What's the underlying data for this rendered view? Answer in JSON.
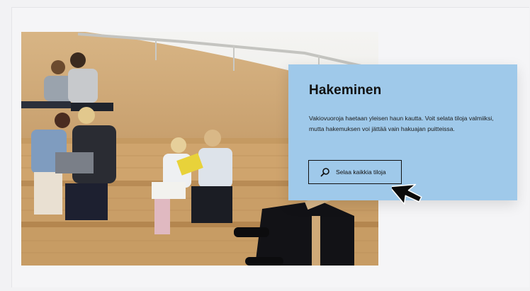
{
  "info": {
    "title": "Hakeminen",
    "text": "Vakiovuoroja haetaan yleisen haun kautta. Voit selata tiloja valmiiksi, mutta hakemuksen voi jättää vain hakuajan puitteissa.",
    "button_label": "Selaa kaikkia tiloja",
    "button_icon": "search-icon"
  },
  "colors": {
    "page_background": "#f2f2f4",
    "info_box_background": "#9fc9ea",
    "text": "#111111"
  },
  "hero_image": {
    "description_icon": "photo-people-on-wooden-stairs"
  }
}
